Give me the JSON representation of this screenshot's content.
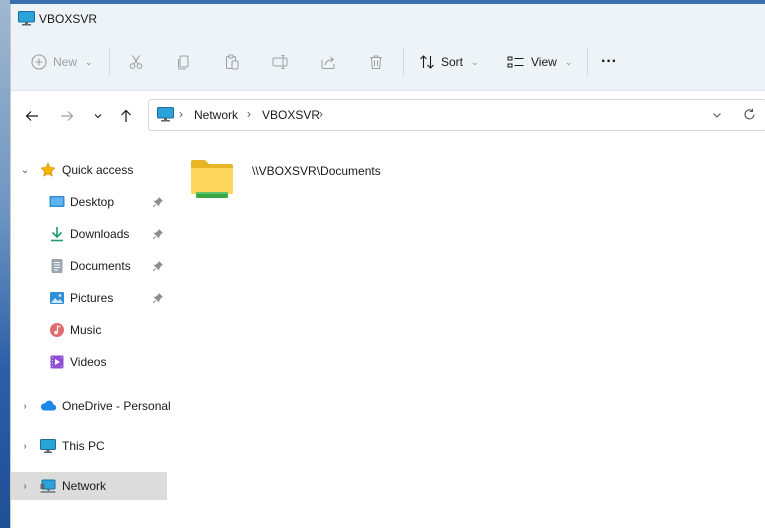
{
  "window": {
    "title": "VBOXSVR"
  },
  "toolbar": {
    "new_label": "New",
    "sort_label": "Sort",
    "view_label": "View",
    "more_label": "···"
  },
  "address": {
    "crumbs": [
      "Network",
      "VBOXSVR"
    ]
  },
  "sidebar": {
    "quick_access": "Quick access",
    "items": [
      {
        "label": "Desktop",
        "icon": "desktop-icon",
        "pinned": true
      },
      {
        "label": "Downloads",
        "icon": "downloads-icon",
        "pinned": true
      },
      {
        "label": "Documents",
        "icon": "documents-icon",
        "pinned": true
      },
      {
        "label": "Pictures",
        "icon": "pictures-icon",
        "pinned": true
      },
      {
        "label": "Music",
        "icon": "music-icon",
        "pinned": false
      },
      {
        "label": "Videos",
        "icon": "videos-icon",
        "pinned": false
      }
    ],
    "onedrive": "OneDrive - Personal",
    "this_pc": "This PC",
    "network": "Network"
  },
  "content": {
    "items": [
      {
        "label": "\\\\VBOXSVR\\Documents",
        "icon": "network-folder-icon"
      }
    ]
  },
  "colors": {
    "accent": "#0067c0",
    "selected_bg": "#dcdcdc",
    "toolbar_bg": "#eef3f8"
  }
}
